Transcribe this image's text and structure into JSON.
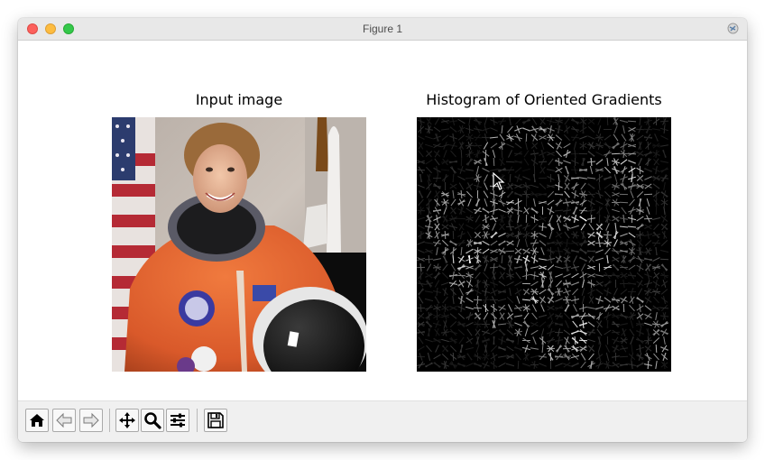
{
  "window": {
    "title": "Figure 1"
  },
  "figure": {
    "left_axes": {
      "title": "Input image"
    },
    "right_axes": {
      "title": "Histogram of Oriented Gradients"
    }
  },
  "toolbar": {
    "buttons": [
      {
        "name": "home",
        "icon": "home-icon"
      },
      {
        "name": "back",
        "icon": "back-arrow-icon"
      },
      {
        "name": "forward",
        "icon": "forward-arrow-icon"
      },
      {
        "name": "pan",
        "icon": "move-icon"
      },
      {
        "name": "zoom",
        "icon": "magnifier-icon"
      },
      {
        "name": "configure-subplots",
        "icon": "sliders-icon"
      },
      {
        "name": "save",
        "icon": "floppy-disk-icon"
      }
    ]
  }
}
